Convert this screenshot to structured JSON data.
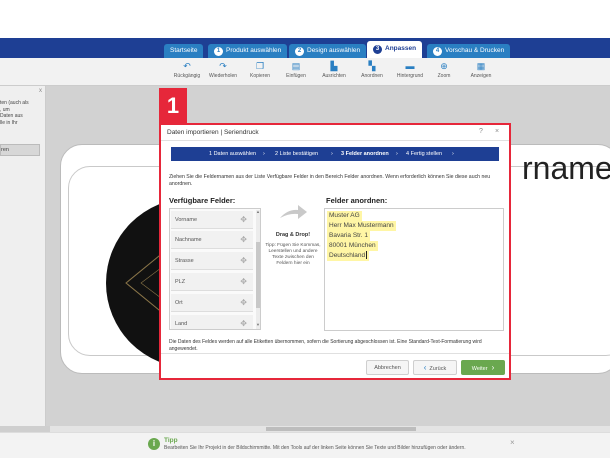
{
  "steps": [
    {
      "num": "",
      "label": "Startseite"
    },
    {
      "num": "1",
      "label": "Produkt auswählen"
    },
    {
      "num": "2",
      "label": "Design auswählen"
    },
    {
      "num": "3",
      "label": "Anpassen"
    },
    {
      "num": "4",
      "label": "Vorschau & Drucken"
    }
  ],
  "toolbar": [
    {
      "icon": "undo-icon",
      "label": "Rückgängig"
    },
    {
      "icon": "redo-icon",
      "label": "Wiederholen"
    },
    {
      "icon": "copy-icon",
      "label": "Kopieren"
    },
    {
      "icon": "paste-icon",
      "label": "Einfügen"
    },
    {
      "icon": "align-icon",
      "label": "Ausrichten"
    },
    {
      "icon": "arrange-icon",
      "label": "Anordnen"
    },
    {
      "icon": "background-icon",
      "label": "Hintergrund"
    },
    {
      "icon": "zoom-icon",
      "label": "Zoom"
    },
    {
      "icon": "grid-icon",
      "label": "Anzeigen"
    }
  ],
  "left_panel": {
    "text": "ten (auch als\n, um\nDaten aus\nlle in Ihr",
    "button": "ren"
  },
  "canvas": {
    "card_text": "rname"
  },
  "badge": "1",
  "dialog": {
    "title": "Daten importieren | Seriendruck",
    "help": "?",
    "close": "×",
    "wizard": [
      {
        "label": "1 Daten auswählen"
      },
      {
        "label": "2 Liste bestätigen"
      },
      {
        "label": "3 Felder anordnen"
      },
      {
        "label": "4 Fertig stellen"
      }
    ],
    "intro": "Ziehen Sie die Feldernamen aus der Liste Verfügbare Felder in den Bereich Felder anordnen. Wenn erforderlich können Sie diese auch neu anordnen.",
    "available_label": "Verfügbare Felder:",
    "arrange_label": "Felder anordnen:",
    "fields": [
      "Vorname",
      "Nachname",
      "Strasse",
      "PLZ",
      "Ort",
      "Land"
    ],
    "drag_title": "Drag & Drop!",
    "drag_tip": "Tipp: Fügen Sie Kommas, Leerstellen und andere Texte zwischen den Feldern hier ein",
    "arranged_lines": [
      "Muster AG",
      "Herr Max Mustermann",
      "Bavaria Str. 1",
      "80001 München",
      "Deutschland"
    ],
    "note": "Die Daten des Feldes werden auf alle Etiketten übernommen, sofern die Sortierung abgeschlossen ist. Eine Standard-Text-Formatierung wird angewendet.",
    "cancel": "Abbrechen",
    "back": "Zurück",
    "next": "Weiter"
  },
  "tip": {
    "title": "Tipp",
    "text": "Bearbeiten Sie Ihr Projekt in der Bildschirmmitte. Mit den Tools auf der linken Seite können Sie Texte und Bilder hinzufügen oder ändern.",
    "close": "×"
  },
  "colors": {
    "nav_blue": "#1e3f94",
    "tab_blue": "#2a7fc2",
    "highlight_red": "#e6273a",
    "green": "#6aa84f",
    "field_highlight": "#fff6a5"
  }
}
